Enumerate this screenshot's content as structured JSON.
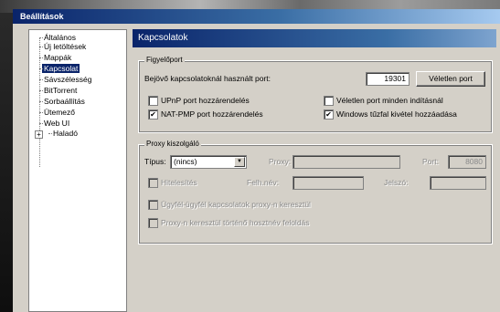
{
  "window": {
    "title": "Beállítások"
  },
  "tree": {
    "items": [
      {
        "label": "Általános",
        "selected": false
      },
      {
        "label": "Új letöltések",
        "selected": false
      },
      {
        "label": "Mappák",
        "selected": false
      },
      {
        "label": "Kapcsolat",
        "selected": true
      },
      {
        "label": "Sávszélesség",
        "selected": false
      },
      {
        "label": "BitTorrent",
        "selected": false
      },
      {
        "label": "Sorbaállítás",
        "selected": false
      },
      {
        "label": "Ütemező",
        "selected": false
      },
      {
        "label": "Web UI",
        "selected": false
      },
      {
        "label": "Haladó",
        "selected": false,
        "expander": "+"
      }
    ]
  },
  "panel": {
    "title": "Kapcsolatok",
    "listening": {
      "group_title": "Figyelőport",
      "port_label": "Bejövő kapcsolatoknál használt port:",
      "port_value": "19301",
      "random_port_button": "Véletlen port",
      "upnp_label": "UPnP port hozzárendelés",
      "upnp_checked": false,
      "random_each_start_label": "Véletlen port minden indításnál",
      "random_each_start_checked": false,
      "natpmp_label": "NAT-PMP port hozzárendelés",
      "natpmp_checked": true,
      "firewall_label": "Windows tűzfal kivétel hozzáadása",
      "firewall_checked": true
    },
    "proxy": {
      "group_title": "Proxy kiszolgáló",
      "type_label": "Típus:",
      "type_value": "(nincs)",
      "host_label": "Proxy:",
      "host_value": "",
      "port_label": "Port:",
      "port_value": "8080",
      "auth_label": "Hitelesítés",
      "auth_checked": false,
      "username_label": "Felh.név:",
      "username_value": "",
      "password_label": "Jelszó:",
      "password_value": "",
      "peer_proxy_label": "Ügyfél-ügyfél kapcsolatok proxy-n keresztül",
      "peer_proxy_checked": false,
      "hostname_lookup_label": "Proxy-n keresztül történő hosztnév feloldás",
      "hostname_lookup_checked": false
    }
  },
  "icons": {
    "checkmark": "✔",
    "dropdown_arrow": "▼"
  }
}
